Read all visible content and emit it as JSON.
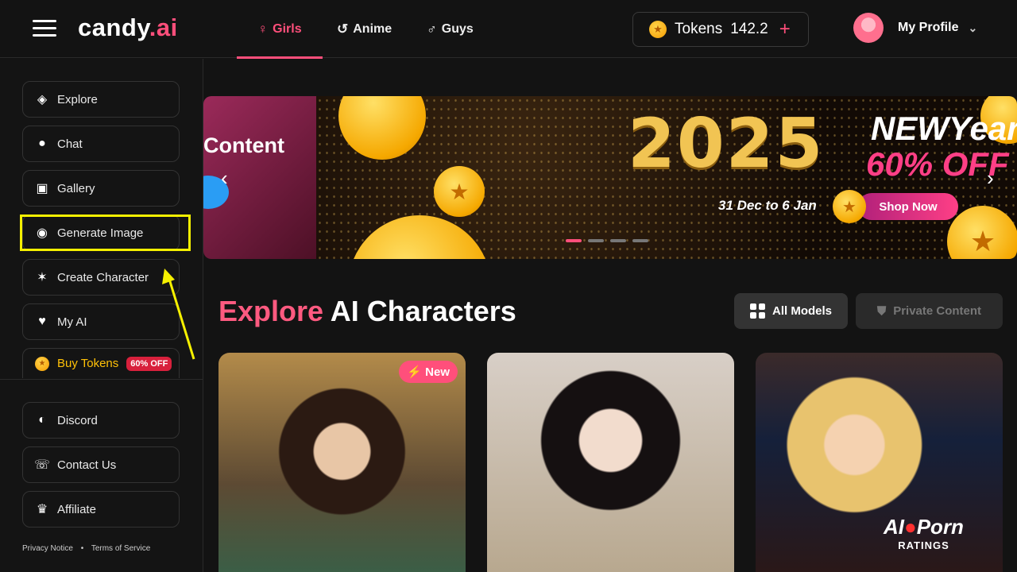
{
  "header": {
    "logo_main": "candy",
    "logo_accent": ".ai",
    "tabs": [
      {
        "label": "Girls",
        "icon": "female-icon",
        "glyph": "♀",
        "active": true
      },
      {
        "label": "Anime",
        "icon": "anime-icon",
        "glyph": "↺",
        "active": false
      },
      {
        "label": "Guys",
        "icon": "male-icon",
        "glyph": "♂",
        "active": false
      }
    ],
    "tokens_label": "Tokens",
    "tokens_value": "142.2",
    "tokens_plus": "+",
    "profile_label": "My Profile"
  },
  "sidebar": {
    "items": [
      {
        "label": "Explore",
        "icon": "compass-icon"
      },
      {
        "label": "Chat",
        "icon": "chat-icon"
      },
      {
        "label": "Gallery",
        "icon": "gallery-icon"
      },
      {
        "label": "Generate Image",
        "icon": "camera-icon"
      },
      {
        "label": "Create Character",
        "icon": "magic-wand-icon"
      },
      {
        "label": "My AI",
        "icon": "heart-icon"
      },
      {
        "label": "Buy Tokens",
        "icon": "coin-icon",
        "badge": "60% OFF"
      }
    ],
    "footer_items": [
      {
        "label": "Discord",
        "icon": "discord-icon"
      },
      {
        "label": "Contact Us",
        "icon": "headset-icon"
      },
      {
        "label": "Affiliate",
        "icon": "trophy-icon"
      }
    ],
    "legal": {
      "privacy": "Privacy Notice",
      "terms": "Terms of Service"
    }
  },
  "banner": {
    "prev_title": "Content",
    "year": "2025",
    "headline": "NEWYear",
    "discount": "60% OFF",
    "dates": "31 Dec to 6 Jan",
    "cta": "Shop Now",
    "slide_count": 4,
    "active_slide": 0
  },
  "section": {
    "title_accent": "Explore",
    "title_rest": "AI Characters",
    "filter_all": "All Models",
    "filter_private": "Private Content"
  },
  "cards": [
    {
      "badge": "⚡ New"
    },
    {
      "badge": ""
    },
    {
      "badge": ""
    }
  ],
  "watermark": {
    "main": "AI",
    "accent": "Porn",
    "sub": "RATINGS"
  },
  "colors": {
    "accent": "#ff4f7b",
    "highlight": "#f5f000",
    "gold": "#ffc107"
  }
}
